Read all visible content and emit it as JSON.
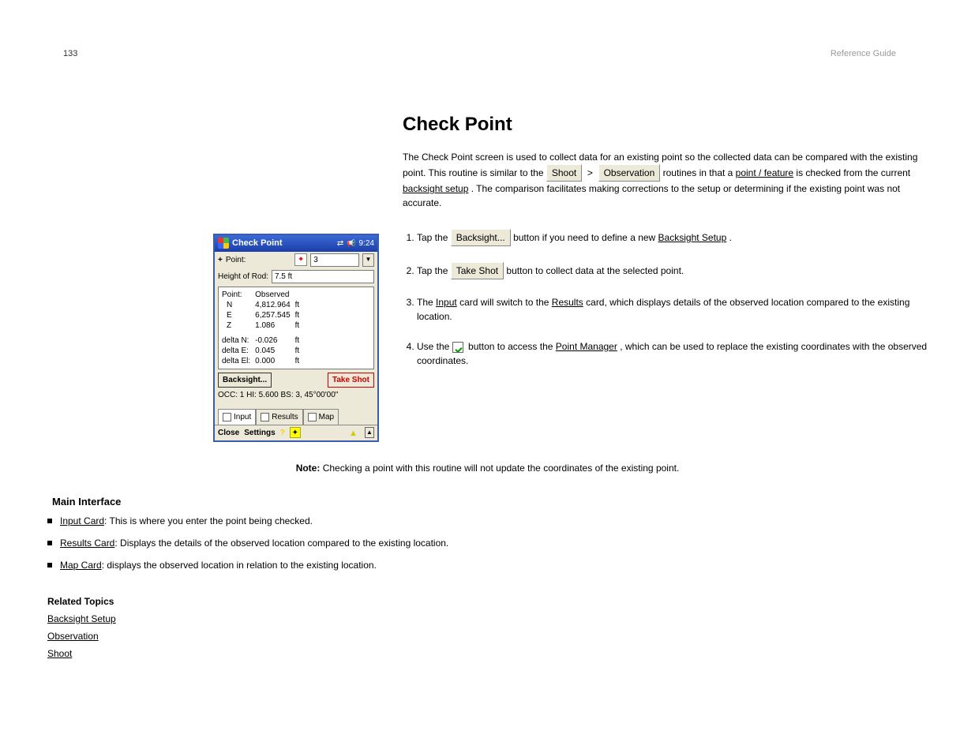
{
  "page": {
    "num": "133",
    "header_note": "Reference Guide"
  },
  "title": "Check Point",
  "intro": {
    "p1a": "The Check Point screen is used to collect data for an existing point so the collected data can be compared with the existing point. This routine is similar to the ",
    "btn_shoot": "Shoot",
    "btn_observation": "Observation",
    "p1b": " routines in that a ",
    "link_point": "point / feature",
    "p1c": " is checked from the current ",
    "link_backsight": "backsight setup",
    "p1d": ". The comparison facilitates making corrections to the setup or determining if the existing point was not accurate."
  },
  "device": {
    "title": "Check Point",
    "time": "9:24",
    "point_lbl": "Point:",
    "point_val": "3",
    "hro_lbl": "Height of Rod:",
    "hro_val": "7.5 ft",
    "obs_hdr": "Observed",
    "rows": {
      "pt": "Point:",
      "N": "N",
      "N_v": "4,812.964",
      "N_u": "ft",
      "E": "E",
      "E_v": "6,257.545",
      "E_u": "ft",
      "Z": "Z",
      "Z_v": "1.086",
      "Z_u": "ft",
      "dN": "delta N:",
      "dN_v": "-0.026",
      "dN_u": "ft",
      "dE": "delta E:",
      "dE_v": "0.045",
      "dE_u": "ft",
      "dEl": "delta El:",
      "dEl_v": "0.000",
      "dEl_u": "ft"
    },
    "backsight_btn": "Backsight...",
    "takeshot_btn": "Take Shot",
    "occ_line": "OCC: 1  HI: 5.600  BS: 3, 45°00'00\"",
    "tab_input": "Input",
    "tab_results": "Results",
    "tab_map": "Map",
    "menu_close": "Close",
    "menu_settings": "Settings"
  },
  "steps": {
    "s1a": "Tap the ",
    "s1btn": "Backsight...",
    "s1b": " button if you need to define a new ",
    "s1link": "Backsight Setup",
    "s1c": ".",
    "s2a": "Tap the ",
    "s2btn": "Take Shot",
    "s2b": " button to collect data at the selected point.",
    "s3a": "The ",
    "s3l1": "Input",
    "s3b": " card will switch to the ",
    "s3l2": "Results",
    "s3c": " card, which displays details of the observed location compared to the existing location.",
    "s4a": "Use the ",
    "s4b": " button to access the ",
    "s4link": "Point Manager",
    "s4c": ", which can be used to replace the existing coordinates with the observed coordinates."
  },
  "note": {
    "bold": "Note:",
    "text": " Checking a point with this routine will not update the coordinates of the existing point."
  },
  "bullets": {
    "b0": "Main Interface",
    "b1_a": "Input Card",
    "b1_b": ": This is where you enter the point being checked.",
    "b2_a": "Results Card",
    "b2_b": ": Displays the details of the observed location compared to the existing location.",
    "b3_a": "Map Card",
    "b3_b": ": displays the observed location in relation to the existing location."
  },
  "related": {
    "hdr": "Related Topics",
    "l1": "Backsight Setup",
    "l2": "Observation",
    "l3": "Shoot"
  }
}
